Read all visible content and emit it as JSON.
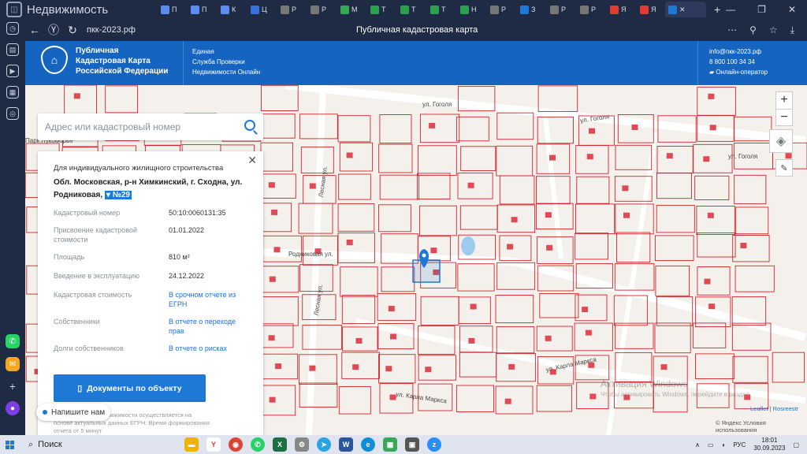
{
  "browser": {
    "brand": "Недвижимость",
    "tabs": [
      {
        "label": "П",
        "color": "#5b8def"
      },
      {
        "label": "П",
        "color": "#5b8def"
      },
      {
        "label": "К",
        "color": "#5b8def"
      },
      {
        "label": "Ц",
        "color": "#3a6fe0"
      },
      {
        "label": "Р",
        "color": "#777777"
      },
      {
        "label": "Р",
        "color": "#777777"
      },
      {
        "label": "М",
        "color": "#34a853"
      },
      {
        "label": "Т",
        "color": "#2e9e4f"
      },
      {
        "label": "Т",
        "color": "#2e9e4f"
      },
      {
        "label": "Т",
        "color": "#2e9e4f"
      },
      {
        "label": "Н",
        "color": "#2e9e4f"
      },
      {
        "label": "Р",
        "color": "#777777"
      },
      {
        "label": "З",
        "color": "#1e78d6"
      },
      {
        "label": "Р",
        "color": "#777777"
      },
      {
        "label": "Р",
        "color": "#777777"
      },
      {
        "label": "Я",
        "color": "#e53935"
      },
      {
        "label": "Я",
        "color": "#e53935"
      }
    ],
    "url": "пкк-2023.рф",
    "page_title": "Публичная кадастровая карта"
  },
  "site": {
    "name_lines": [
      "Публичная",
      "Кадастровая Карта",
      "Российской Федерации"
    ],
    "sub_lines": [
      "Единая",
      "Служба Проверки",
      "Недвижимости Онлайн"
    ],
    "email": "info@пкк-2023.рф",
    "phone": "8 800 100 34 34",
    "operator": "Онлайн-оператор"
  },
  "search": {
    "placeholder": "Адрес или кадастровый номер"
  },
  "card": {
    "purpose": "Для индивидуального жилищного строительства",
    "address_main": "Обл. Московская, р-н Химкинский, г. Сходна, ул. Родниковая,",
    "address_hl": "№29",
    "fields": [
      {
        "label": "Кадастровый номер",
        "value": "50:10:0060131:35"
      },
      {
        "label": "Присвоение кадастровой стоимости",
        "value": "01.01.2022"
      },
      {
        "label": "Площадь",
        "value": "810 м²"
      },
      {
        "label": "Введение в эксплуатацию",
        "value": "24.12.2022"
      }
    ],
    "links": [
      {
        "label": "Кадастровая стоимость",
        "value": "В срочном отчете из ЕГРН"
      },
      {
        "label": "Собственники",
        "value": "В отчете о переходе прав"
      },
      {
        "label": "Долги собственников",
        "value": "В отчете о рисках"
      }
    ],
    "doc_button": "Документы по объекту",
    "footnote": "ние сведений о недвижимости осуществляется на основе актуальных данных ЕГРН. Время формирования отчета от 5 минут"
  },
  "map": {
    "streets": [
      {
        "text": "ул. Гоголя"
      },
      {
        "text": "ул. Гоголя"
      },
      {
        "text": "ул. Гоголя"
      },
      {
        "text": "Родниковая ул."
      },
      {
        "text": "ул. Карла Маркса"
      },
      {
        "text": "ул. Карла Маркса"
      },
      {
        "text": "Лесная ул."
      },
      {
        "text": "Лесная ул."
      },
      {
        "text": "Парк Лукоморье"
      }
    ],
    "chat": "Напишите нам",
    "attribution_leaflet": "Leaflet",
    "attribution_rosreestr": "Rosreestr",
    "yandex": "© Яндекс Условия использования",
    "watermark_line1": "Активация Windows",
    "watermark_line2": "Чтобы активировать Windows, перейдите в раздел"
  },
  "taskbar": {
    "search": "Поиск",
    "lang": "РУС",
    "time": "18:01",
    "date": "30.09.2023"
  }
}
